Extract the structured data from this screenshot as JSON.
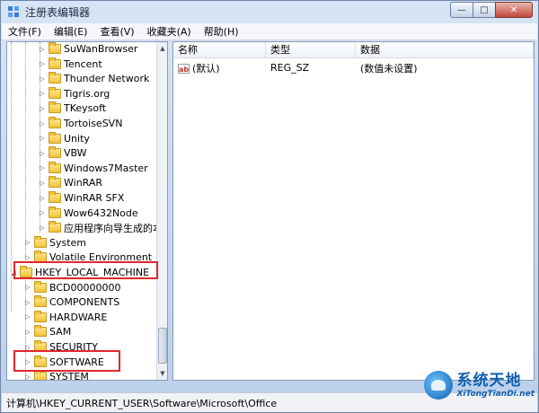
{
  "window": {
    "title": "注册表编辑器",
    "minimize": "—",
    "maximize": "□",
    "close": "✕"
  },
  "menubar": {
    "items": [
      "文件(F)",
      "编辑(E)",
      "查看(V)",
      "收藏夹(A)",
      "帮助(H)"
    ]
  },
  "tree": {
    "rows": [
      {
        "label": "SuWanBrowser",
        "level": 2
      },
      {
        "label": "Tencent",
        "level": 2
      },
      {
        "label": "Thunder Network",
        "level": 2
      },
      {
        "label": "Tigris.org",
        "level": 2
      },
      {
        "label": "TKeysoft",
        "level": 2
      },
      {
        "label": "TortoiseSVN",
        "level": 2
      },
      {
        "label": "Unity",
        "level": 2
      },
      {
        "label": "VBW",
        "level": 2
      },
      {
        "label": "Windows7Master",
        "level": 2
      },
      {
        "label": "WinRAR",
        "level": 2
      },
      {
        "label": "WinRAR SFX",
        "level": 2
      },
      {
        "label": "Wow6432Node",
        "level": 2
      },
      {
        "label": "应用程序向导生成的本",
        "level": 2
      },
      {
        "label": "System",
        "level": 1
      },
      {
        "label": "Volatile Environment",
        "level": 1
      },
      {
        "label": "HKEY_LOCAL_MACHINE",
        "level": 0,
        "expanded": true
      },
      {
        "label": "BCD00000000",
        "level": 1
      },
      {
        "label": "COMPONENTS",
        "level": 1
      },
      {
        "label": "HARDWARE",
        "level": 1
      },
      {
        "label": "SAM",
        "level": 1
      },
      {
        "label": "SECURITY",
        "level": 1
      },
      {
        "label": "SOFTWARE",
        "level": 1
      },
      {
        "label": "SYSTEM",
        "level": 1
      }
    ]
  },
  "list": {
    "columns": [
      "名称",
      "类型",
      "数据"
    ],
    "rows": [
      {
        "icon": "ab",
        "name": "(默认)",
        "type": "REG_SZ",
        "data": "(数值未设置)"
      }
    ]
  },
  "statusbar": {
    "path": "计算机\\HKEY_CURRENT_USER\\Software\\Microsoft\\Office"
  },
  "watermark": {
    "main": "系统天地",
    "sub": "XiTongTianDi.net"
  },
  "colors": {
    "highlight": "#e3262d",
    "folder": "#f2c23a"
  }
}
